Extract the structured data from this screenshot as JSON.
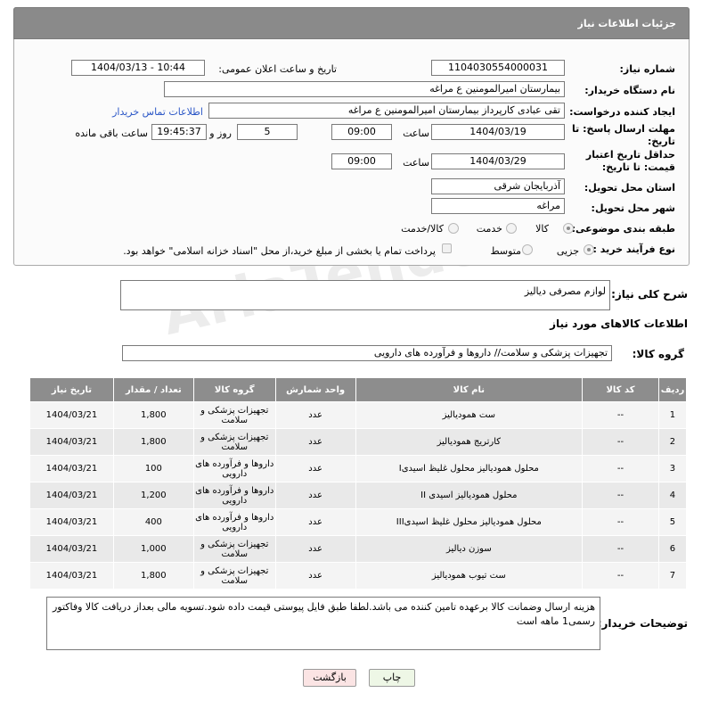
{
  "header": {
    "title": "جزئیات اطلاعات نیاز"
  },
  "form": {
    "need_number_label": "شماره نیاز:",
    "need_number": "1104030554000031",
    "announce_label": "تاریخ و ساعت اعلان عمومی:",
    "announce_value": "1404/03/13 - 10:44",
    "buyer_label": "نام دستگاه خریدار:",
    "buyer_value": "بیمارستان امیرالمومنین ع  مراغه",
    "creator_label": "ایجاد کننده درخواست:",
    "creator_value": "تقی عبادی کارپرداز بیمارستان امیرالمومنین ع  مراغه",
    "contact_link": "اطلاعات تماس خریدار",
    "deadline_label": "مهلت ارسال پاسخ: تا تاریخ:",
    "deadline_date": "1404/03/19",
    "time_label": "ساعت",
    "deadline_time": "09:00",
    "days_value": "5",
    "days_label": "روز و",
    "remaining_time": "19:45:37",
    "remaining_label": "ساعت باقی مانده",
    "min_validity_label": "حداقل تاریخ اعتبار قیمت: تا تاریخ:",
    "validity_date": "1404/03/29",
    "validity_time": "09:00",
    "province_label": "استان محل تحویل:",
    "province_value": "آذربایجان شرقی",
    "city_label": "شهر محل تحویل:",
    "city_value": "مراغه",
    "category_label": "طبقه بندی موضوعی:",
    "cat_options": [
      "کالا",
      "خدمت",
      "کالا/خدمت"
    ],
    "process_label": "نوع فرآیند خرید :",
    "process_options": [
      "جزیی",
      "متوسط"
    ],
    "payment_note": "پرداخت تمام یا بخشی از مبلغ خرید،از محل \"اسناد خزانه اسلامی\" خواهد بود."
  },
  "summary": {
    "label": "شرح کلی نیاز:",
    "value": "لوازم مصرفی دیالیز"
  },
  "goods_info_title": "اطلاعات کالاهای مورد نیاز",
  "goods_group": {
    "label": "گروه کالا:",
    "value": "تجهیزات پزشکی و سلامت// داروها و فرآورده های دارویی"
  },
  "table": {
    "headers": [
      "ردیف",
      "کد کالا",
      "نام کالا",
      "واحد شمارش",
      "گروه کالا",
      "تعداد / مقدار",
      "تاریخ نیاز"
    ],
    "rows": [
      [
        "1",
        "--",
        "ست همودیالیز",
        "عدد",
        "تجهیزات پزشکی و سلامت",
        "1,800",
        "1404/03/21"
      ],
      [
        "2",
        "--",
        "کارتریج همودیالیز",
        "عدد",
        "تجهیزات پزشکی و سلامت",
        "1,800",
        "1404/03/21"
      ],
      [
        "3",
        "--",
        "محلول همودیالیز محلول غلیظ اسیدیI",
        "عدد",
        "داروها و فرآورده های دارویی",
        "100",
        "1404/03/21"
      ],
      [
        "4",
        "--",
        "محلول همودیالیز اسیدی II",
        "عدد",
        "داروها و فرآورده های دارویی",
        "1,200",
        "1404/03/21"
      ],
      [
        "5",
        "--",
        "محلول همودیالیز محلول غلیظ اسیدیIII",
        "عدد",
        "داروها و فرآورده های دارویی",
        "400",
        "1404/03/21"
      ],
      [
        "6",
        "--",
        "سوزن دیالیز",
        "عدد",
        "تجهیزات پزشکی و سلامت",
        "1,000",
        "1404/03/21"
      ],
      [
        "7",
        "--",
        "ست تیوب همودیالیز",
        "عدد",
        "تجهیزات پزشکی و سلامت",
        "1,800",
        "1404/03/21"
      ]
    ]
  },
  "buyer_notes": {
    "label": "توضیحات خریدار:",
    "value": "هزینه ارسال وضمانت  کالا برعهده تامین کننده می باشد.لطفا طبق فایل پیوستی قیمت داده شود.تسویه مالی بعداز دریافت کالا وفاکتور رسمی1 ماهه است"
  },
  "buttons": {
    "print": "چاپ",
    "back": "بازگشت"
  },
  "watermark": "AriaTender.neT"
}
